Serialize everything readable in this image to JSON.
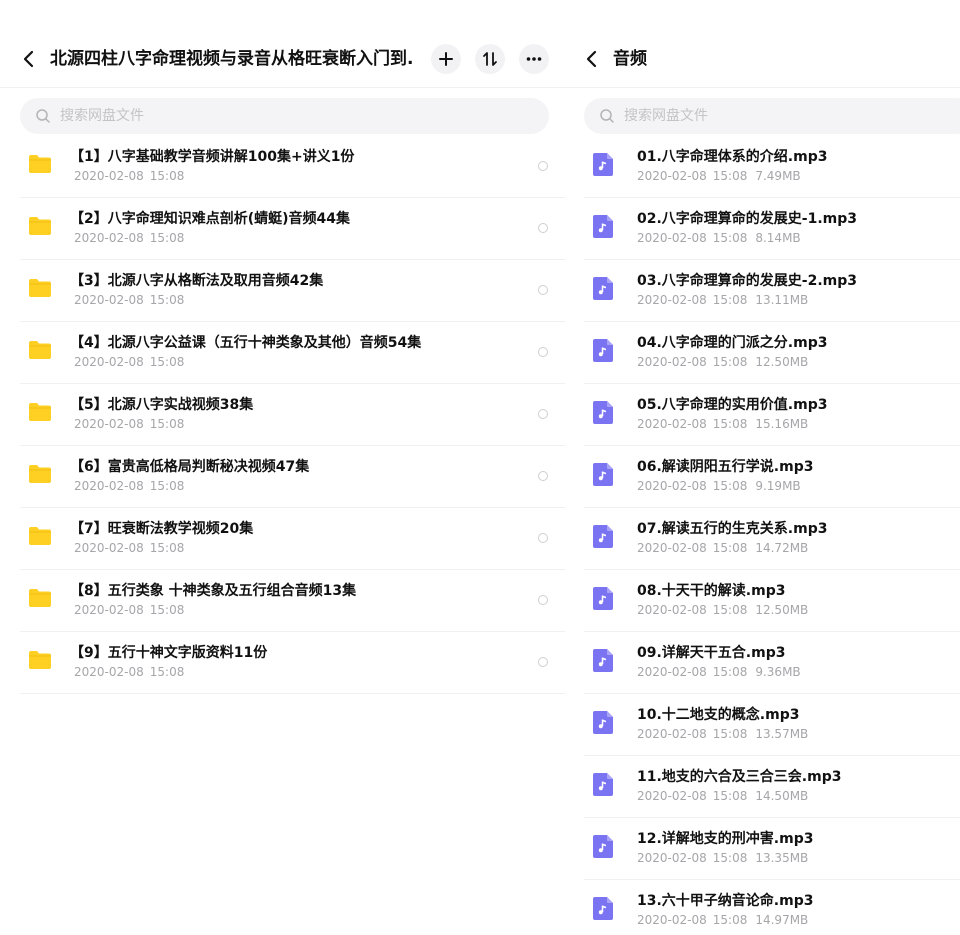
{
  "left": {
    "title": "北源四柱八字命理视频与录音从格旺衰断入门到...",
    "search_placeholder": "搜索网盘文件",
    "items": [
      {
        "name": "【1】八字基础教学音频讲解100集+讲义1份",
        "date": "2020-02-08",
        "time": "15:08"
      },
      {
        "name": "【2】八字命理知识难点剖析(蜻蜓)音频44集",
        "date": "2020-02-08",
        "time": "15:08"
      },
      {
        "name": "【3】北源八字从格断法及取用音频42集",
        "date": "2020-02-08",
        "time": "15:08"
      },
      {
        "name": "【4】北源八字公益课（五行十神类象及其他）音频54集",
        "date": "2020-02-08",
        "time": "15:08"
      },
      {
        "name": "【5】北源八字实战视频38集",
        "date": "2020-02-08",
        "time": "15:08"
      },
      {
        "name": "【6】富贵高低格局判断秘决视频47集",
        "date": "2020-02-08",
        "time": "15:08"
      },
      {
        "name": "【7】旺衰断法教学视频20集",
        "date": "2020-02-08",
        "time": "15:08"
      },
      {
        "name": "【8】五行类象 十神类象及五行组合音频13集",
        "date": "2020-02-08",
        "time": "15:08"
      },
      {
        "name": "【9】五行十神文字版资料11份",
        "date": "2020-02-08",
        "time": "15:08"
      }
    ]
  },
  "right": {
    "title": "音频",
    "search_placeholder": "搜索网盘文件",
    "items": [
      {
        "name": "01.八字命理体系的介绍.mp3",
        "date": "2020-02-08",
        "time": "15:08",
        "size": "7.49MB"
      },
      {
        "name": "02.八字命理算命的发展史-1.mp3",
        "date": "2020-02-08",
        "time": "15:08",
        "size": "8.14MB"
      },
      {
        "name": "03.八字命理算命的发展史-2.mp3",
        "date": "2020-02-08",
        "time": "15:08",
        "size": "13.11MB"
      },
      {
        "name": "04.八字命理的门派之分.mp3",
        "date": "2020-02-08",
        "time": "15:08",
        "size": "12.50MB"
      },
      {
        "name": "05.八字命理的实用价值.mp3",
        "date": "2020-02-08",
        "time": "15:08",
        "size": "15.16MB"
      },
      {
        "name": "06.解读阴阳五行学说.mp3",
        "date": "2020-02-08",
        "time": "15:08",
        "size": "9.19MB"
      },
      {
        "name": "07.解读五行的生克关系.mp3",
        "date": "2020-02-08",
        "time": "15:08",
        "size": "14.72MB"
      },
      {
        "name": "08.十天干的解读.mp3",
        "date": "2020-02-08",
        "time": "15:08",
        "size": "12.50MB"
      },
      {
        "name": "09.详解天干五合.mp3",
        "date": "2020-02-08",
        "time": "15:08",
        "size": "9.36MB"
      },
      {
        "name": "10.十二地支的概念.mp3",
        "date": "2020-02-08",
        "time": "15:08",
        "size": "13.57MB"
      },
      {
        "name": "11.地支的六合及三合三会.mp3",
        "date": "2020-02-08",
        "time": "15:08",
        "size": "14.50MB"
      },
      {
        "name": "12.详解地支的刑冲害.mp3",
        "date": "2020-02-08",
        "time": "15:08",
        "size": "13.35MB"
      },
      {
        "name": "13.六十甲子纳音论命.mp3",
        "date": "2020-02-08",
        "time": "15:08",
        "size": "14.97MB"
      }
    ]
  },
  "icons": {
    "back": "chevron-left-icon",
    "add": "plus-icon",
    "sort": "sort-icon",
    "more": "more-icon",
    "search": "search-icon",
    "folder": "folder-icon",
    "audio": "audio-file-icon"
  },
  "colors": {
    "folder": "#FFD024",
    "audio": "#7B74F2",
    "meta_text": "#A6A6AA",
    "search_bg": "#F4F4F6"
  }
}
